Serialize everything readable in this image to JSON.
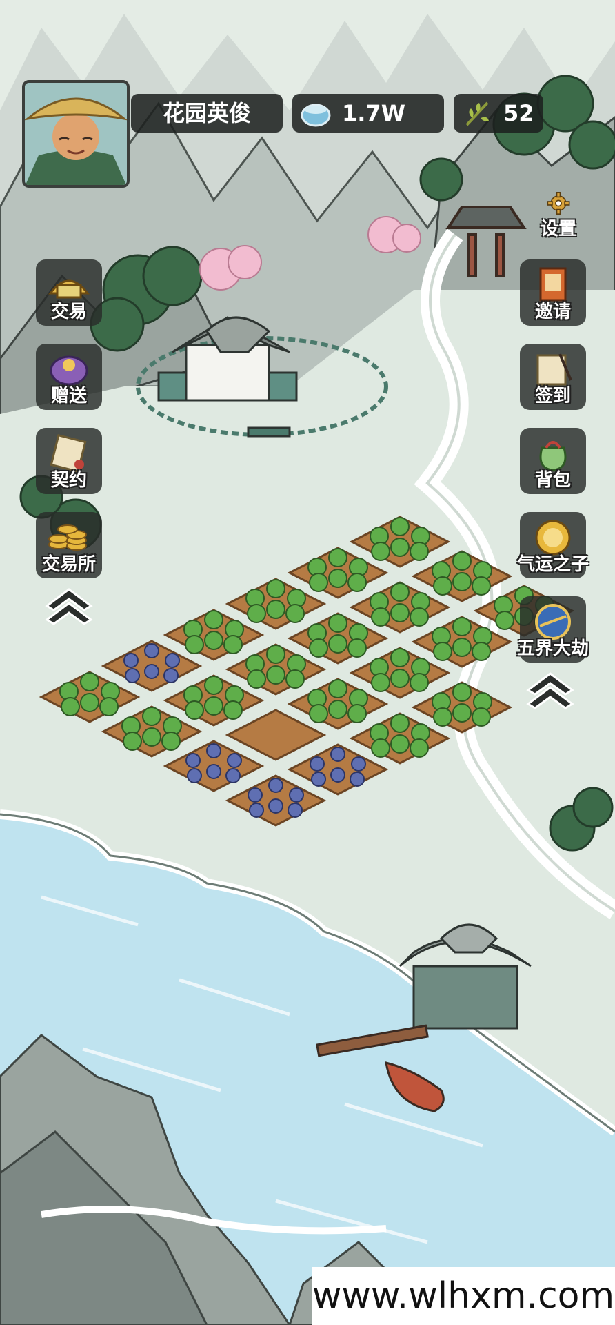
{
  "player": {
    "name": "花园英俊",
    "avatar": "farmer-avatar"
  },
  "currencies": {
    "coins": "1.7W",
    "coin_icon": "jade-bowl-icon",
    "stamina": "52",
    "stamina_icon": "herb-icon"
  },
  "left_menu": [
    {
      "label": "交易",
      "icon": "trade-icon"
    },
    {
      "label": "赠送",
      "icon": "gift-icon"
    },
    {
      "label": "契约",
      "icon": "contract-scroll-icon"
    },
    {
      "label": "交易所",
      "icon": "coin-stack-icon"
    }
  ],
  "right_menu": [
    {
      "label": "邀请",
      "icon": "invite-icon"
    },
    {
      "label": "签到",
      "icon": "checkin-icon"
    },
    {
      "label": "背包",
      "icon": "bag-icon"
    },
    {
      "label": "气运之子",
      "icon": "fortune-icon"
    },
    {
      "label": "五界大劫",
      "icon": "calamity-icon"
    }
  ],
  "settings": {
    "label": "设置",
    "icon": "gear-icon"
  },
  "watermark": "www.wlhxm.com",
  "colors": {
    "panel": "#1c1f1e",
    "text": "#ffffff",
    "soil": "#b57b44",
    "crop": "#5fae4a",
    "water": "#bfe3ef"
  }
}
